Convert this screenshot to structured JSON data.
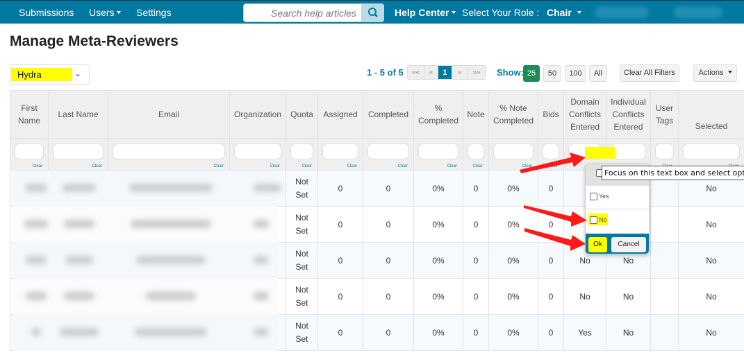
{
  "navbar": {
    "items": [
      {
        "label": "Submissions",
        "dropdown": false
      },
      {
        "label": "Users",
        "dropdown": true
      },
      {
        "label": "Settings",
        "dropdown": false
      }
    ],
    "search_placeholder": "Search help articles",
    "search_icon": "search-icon",
    "help_center": "Help Center",
    "role_label": "Select Your Role :",
    "role_value": "Chair"
  },
  "page": {
    "title": "Manage Meta-Reviewers",
    "conference_select": "Hydra"
  },
  "pagination": {
    "info_prefix": "1 - 5 of ",
    "info_total": "5",
    "buttons": [
      "««",
      "«",
      "1",
      "»",
      "»»"
    ],
    "current": "1"
  },
  "show": {
    "label": "Show:",
    "options": [
      "25",
      "50",
      "100",
      "All"
    ],
    "selected": "25"
  },
  "toolbar": {
    "clear_filters": "Clear All Filters",
    "actions": "Actions"
  },
  "table": {
    "columns": [
      "First Name",
      "Last Name",
      "Email",
      "Organization",
      "Quota",
      "Assigned",
      "Completed",
      "% Completed",
      "Note",
      "% Note Completed",
      "Bids",
      "Domain Conflicts Entered",
      "Individual Conflicts Entered",
      "User Tags",
      "Selected"
    ],
    "filter_clear_label": "Clear",
    "rows": [
      {
        "quota": "Not Set",
        "assigned": "0",
        "completed": "0",
        "pct_completed": "0%",
        "note": "0",
        "pct_note": "0%",
        "bids": "0",
        "domain_conflicts": "",
        "individual_conflicts": "",
        "user_tags": "",
        "selected": "No"
      },
      {
        "quota": "Not Set",
        "assigned": "0",
        "completed": "0",
        "pct_completed": "0%",
        "note": "0",
        "pct_note": "0%",
        "bids": "0",
        "domain_conflicts": "",
        "individual_conflicts": "",
        "user_tags": "",
        "selected": "No"
      },
      {
        "quota": "Not Set",
        "assigned": "0",
        "completed": "0",
        "pct_completed": "0%",
        "note": "0",
        "pct_note": "0%",
        "bids": "0",
        "domain_conflicts": "No",
        "individual_conflicts": "No",
        "user_tags": "",
        "selected": "No"
      },
      {
        "quota": "Not Set",
        "assigned": "0",
        "completed": "0",
        "pct_completed": "0%",
        "note": "0",
        "pct_note": "0%",
        "bids": "0",
        "domain_conflicts": "No",
        "individual_conflicts": "No",
        "user_tags": "",
        "selected": "No"
      },
      {
        "quota": "Not Set",
        "assigned": "0",
        "completed": "0",
        "pct_completed": "0%",
        "note": "0",
        "pct_note": "0%",
        "bids": "0",
        "domain_conflicts": "Yes",
        "individual_conflicts": "No",
        "user_tags": "",
        "selected": "No"
      }
    ]
  },
  "filter_popup": {
    "options": [
      "Yes",
      "No"
    ],
    "ok": "Ok",
    "cancel": "Cancel",
    "tooltip": "Focus on this text box and select optio"
  },
  "highlight_color": "#ffff00",
  "brand_color": "#0079a1",
  "arrow_color": "#ff1a1a"
}
